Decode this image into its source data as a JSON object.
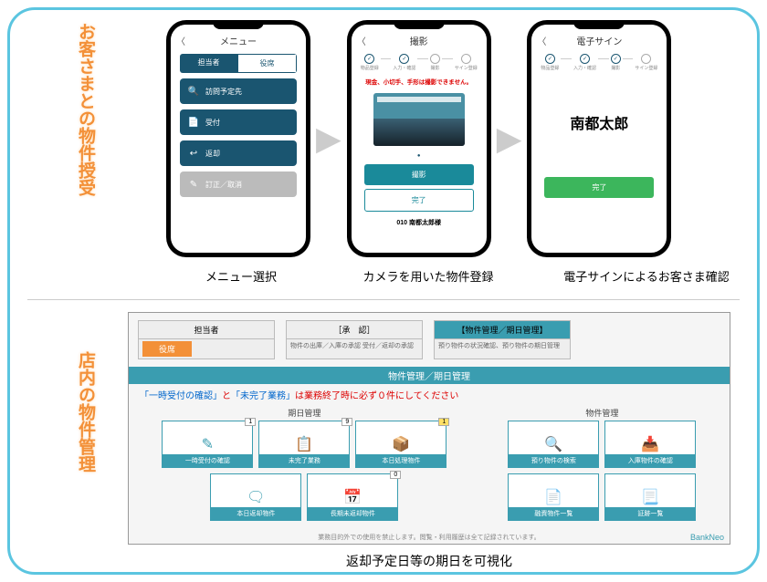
{
  "sections": {
    "top_label": "お客さまとの物件授受",
    "bottom_label": "店内の物件管理"
  },
  "phone1": {
    "title": "メニュー",
    "seg_active": "担当者",
    "seg_inactive": "役席",
    "items": [
      "訪問予定先",
      "受付",
      "返却",
      "訂正／取消"
    ],
    "caption": "メニュー選択"
  },
  "phone2": {
    "title": "撮影",
    "steps": [
      "物品登録",
      "入力・確認",
      "撮影",
      "サイン登録"
    ],
    "warning": "現金、小切手、手形は撮影できません。",
    "btn_shoot": "撮影",
    "btn_done": "完了",
    "customer": "010 南都太郎様",
    "caption": "カメラを用いた物件登録"
  },
  "phone3": {
    "title": "電子サイン",
    "steps": [
      "物品登録",
      "入力・確認",
      "撮影",
      "サイン登録"
    ],
    "signature": "南都太郎",
    "btn_done": "完了",
    "caption": "電子サインによるお客さま確認"
  },
  "desktop": {
    "tab1": {
      "h": "担当者",
      "b": "役席"
    },
    "tab2": {
      "h": "［承　認］",
      "b": "物件の出庫／入庫の承認\n受付／返却の承認"
    },
    "tab3": {
      "h": "【物件管理／期日管理】",
      "b": "預り物件の状況確認、預り物件の期日管理"
    },
    "titlebar": "物件管理／期日管理",
    "warning_pre": "「一時受付の確認」",
    "warning_mid": "と",
    "warning_pre2": "「未完了業務」",
    "warning_post": "は業務終了時に必ず０件にしてください",
    "panel_l": "期日管理",
    "panel_r": "物件管理",
    "cards_l": [
      {
        "label": "一時受付の確認",
        "badge": "1"
      },
      {
        "label": "未完了業務",
        "badge": "9"
      },
      {
        "label": "本日処理物件",
        "badge": "1",
        "by": true
      },
      {
        "label": "本日返却物件"
      },
      {
        "label": "長期未返却物件",
        "badge": "0"
      }
    ],
    "cards_r": [
      {
        "label": "預り物件の検索"
      },
      {
        "label": "入庫物件の確認"
      },
      {
        "label": "融資物件一覧"
      },
      {
        "label": "証跡一覧"
      }
    ],
    "footer": "業務目的外での使用を禁止します。閲覧・利用履歴は全て記録されています。",
    "brand": "BankNeo",
    "caption": "返却予定日等の期日を可視化"
  }
}
